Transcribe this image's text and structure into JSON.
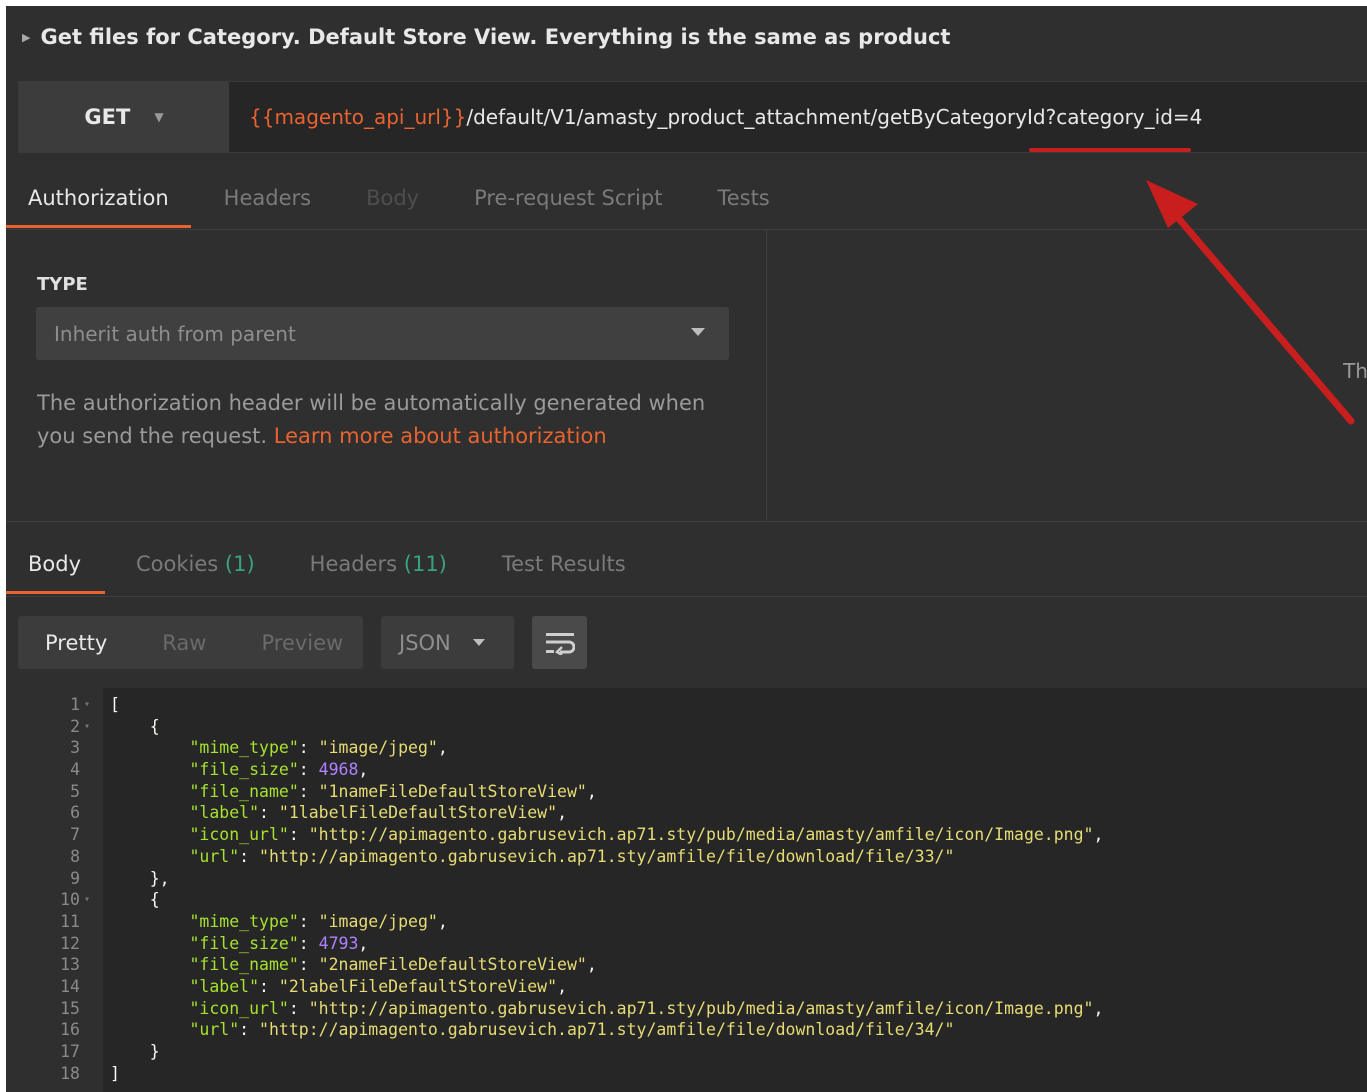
{
  "request": {
    "title": "Get files for Category. Default Store View. Everything is the same as product",
    "method": "GET",
    "url_variable": "{{magento_api_url}}",
    "url_path": "/default/V1/amasty_product_attachment/getByCategoryId?category_id=4"
  },
  "request_tabs": [
    {
      "label": "Authorization",
      "state": "active"
    },
    {
      "label": "Headers",
      "state": "inactive"
    },
    {
      "label": "Body",
      "state": "disabled"
    },
    {
      "label": "Pre-request Script",
      "state": "inactive"
    },
    {
      "label": "Tests",
      "state": "inactive"
    }
  ],
  "auth": {
    "type_label": "TYPE",
    "selected": "Inherit auth from parent",
    "help_text": "The authorization header will be automatically generated when you send the request.",
    "help_link": "Learn more about authorization",
    "right_truncated": "Th"
  },
  "response_tabs": [
    {
      "label": "Body",
      "count": ""
    },
    {
      "label": "Cookies",
      "count": "(1)"
    },
    {
      "label": "Headers",
      "count": "(11)"
    },
    {
      "label": "Test Results",
      "count": ""
    }
  ],
  "view_modes": [
    "Pretty",
    "Raw",
    "Preview"
  ],
  "format": "JSON",
  "colors": {
    "accent": "#e8632f",
    "annotation": "#c81e1e",
    "count": "#37a37e"
  },
  "code_lines": [
    "[",
    "    {",
    "        \"mime_type\": \"image/jpeg\",",
    "        \"file_size\": 4968,",
    "        \"file_name\": \"1nameFileDefaultStoreView\",",
    "        \"label\": \"1labelFileDefaultStoreView\",",
    "        \"icon_url\": \"http://apimagento.gabrusevich.ap71.sty/pub/media/amasty/amfile/icon/Image.png\",",
    "        \"url\": \"http://apimagento.gabrusevich.ap71.sty/amfile/file/download/file/33/\"",
    "    },",
    "    {",
    "        \"mime_type\": \"image/jpeg\",",
    "        \"file_size\": 4793,",
    "        \"file_name\": \"2nameFileDefaultStoreView\",",
    "        \"label\": \"2labelFileDefaultStoreView\",",
    "        \"icon_url\": \"http://apimagento.gabrusevich.ap71.sty/pub/media/amasty/amfile/icon/Image.png\",",
    "        \"url\": \"http://apimagento.gabrusevich.ap71.sty/amfile/file/download/file/34/\"",
    "    }",
    "]"
  ],
  "fold_lines": [
    1,
    2,
    10
  ]
}
